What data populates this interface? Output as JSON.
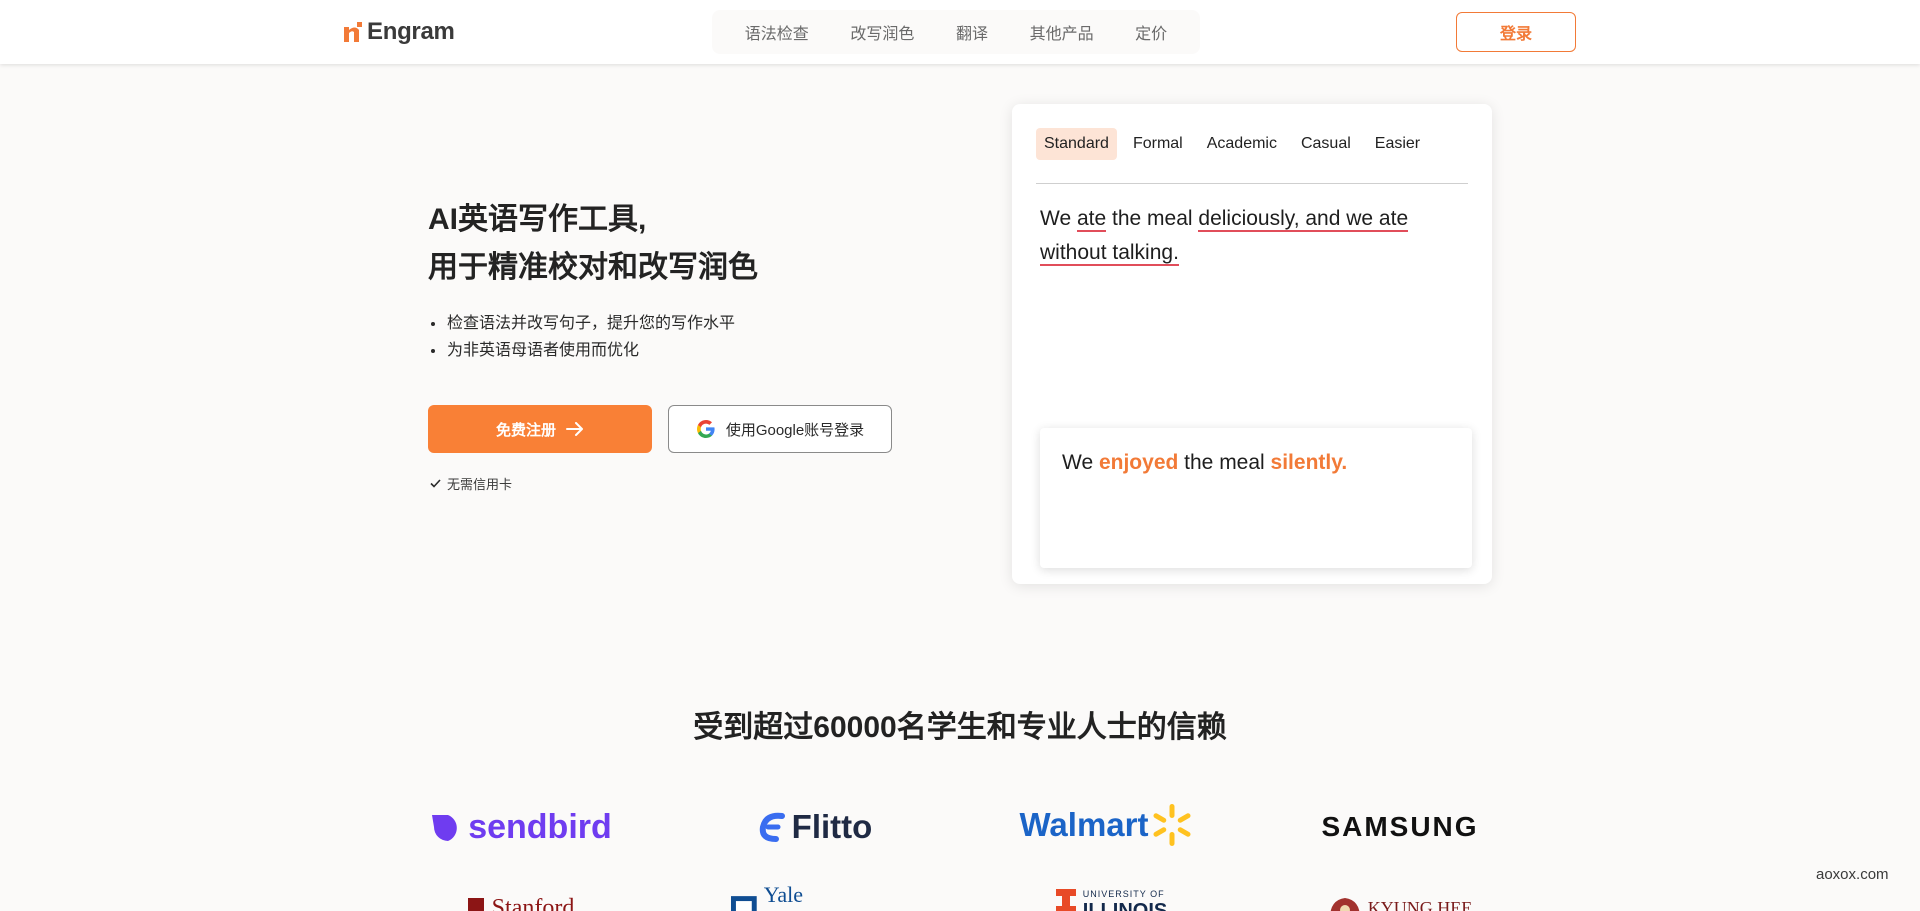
{
  "brand": {
    "name": "Engram",
    "color": "#f27a37"
  },
  "nav": {
    "items": [
      "语法检查",
      "改写润色",
      "翻译",
      "其他产品",
      "定价"
    ],
    "login_label": "登录"
  },
  "hero": {
    "title_line1": "AI英语写作工具,",
    "title_line2": "用于精准校对和改写润色",
    "bullets": [
      "检查语法并改写句子，提升您的写作水平",
      "为非英语母语者使用而优化"
    ],
    "signup_label": "免费注册",
    "google_label": "使用Google账号登录",
    "no_card_label": "无需信用卡"
  },
  "demo": {
    "tabs": [
      "Standard",
      "Formal",
      "Academic",
      "Casual",
      "Easier"
    ],
    "active_tab": "Standard",
    "input": {
      "p1": "We ",
      "e1": "ate",
      "p2": " the meal ",
      "e2": "deliciously, and we ate without talking."
    },
    "output": {
      "p1": "We ",
      "h1": "enjoyed",
      "p2": " the meal ",
      "h2": "silently."
    }
  },
  "trust": {
    "title": "受到超过60000名学生和专业人士的信赖",
    "logos": {
      "sendbird": "sendbird",
      "flitto": "Flitto",
      "walmart": "Walmart",
      "samsung": "SAMSUNG",
      "stanford": "Stanford",
      "yale": "Yale University",
      "illinois_small": "UNIVERSITY OF",
      "illinois_big": "ILLINOIS",
      "kyunghee": "KYUNG HEE"
    }
  },
  "watermark": "aoxox.com",
  "colors": {
    "accent": "#f98036",
    "error_underline": "#e14d5a",
    "tab_active_bg": "#fde4d6"
  },
  "icons": [
    "engram-logo-icon",
    "arrow-right-icon",
    "google-g-icon",
    "check-icon",
    "walmart-spark-icon"
  ]
}
